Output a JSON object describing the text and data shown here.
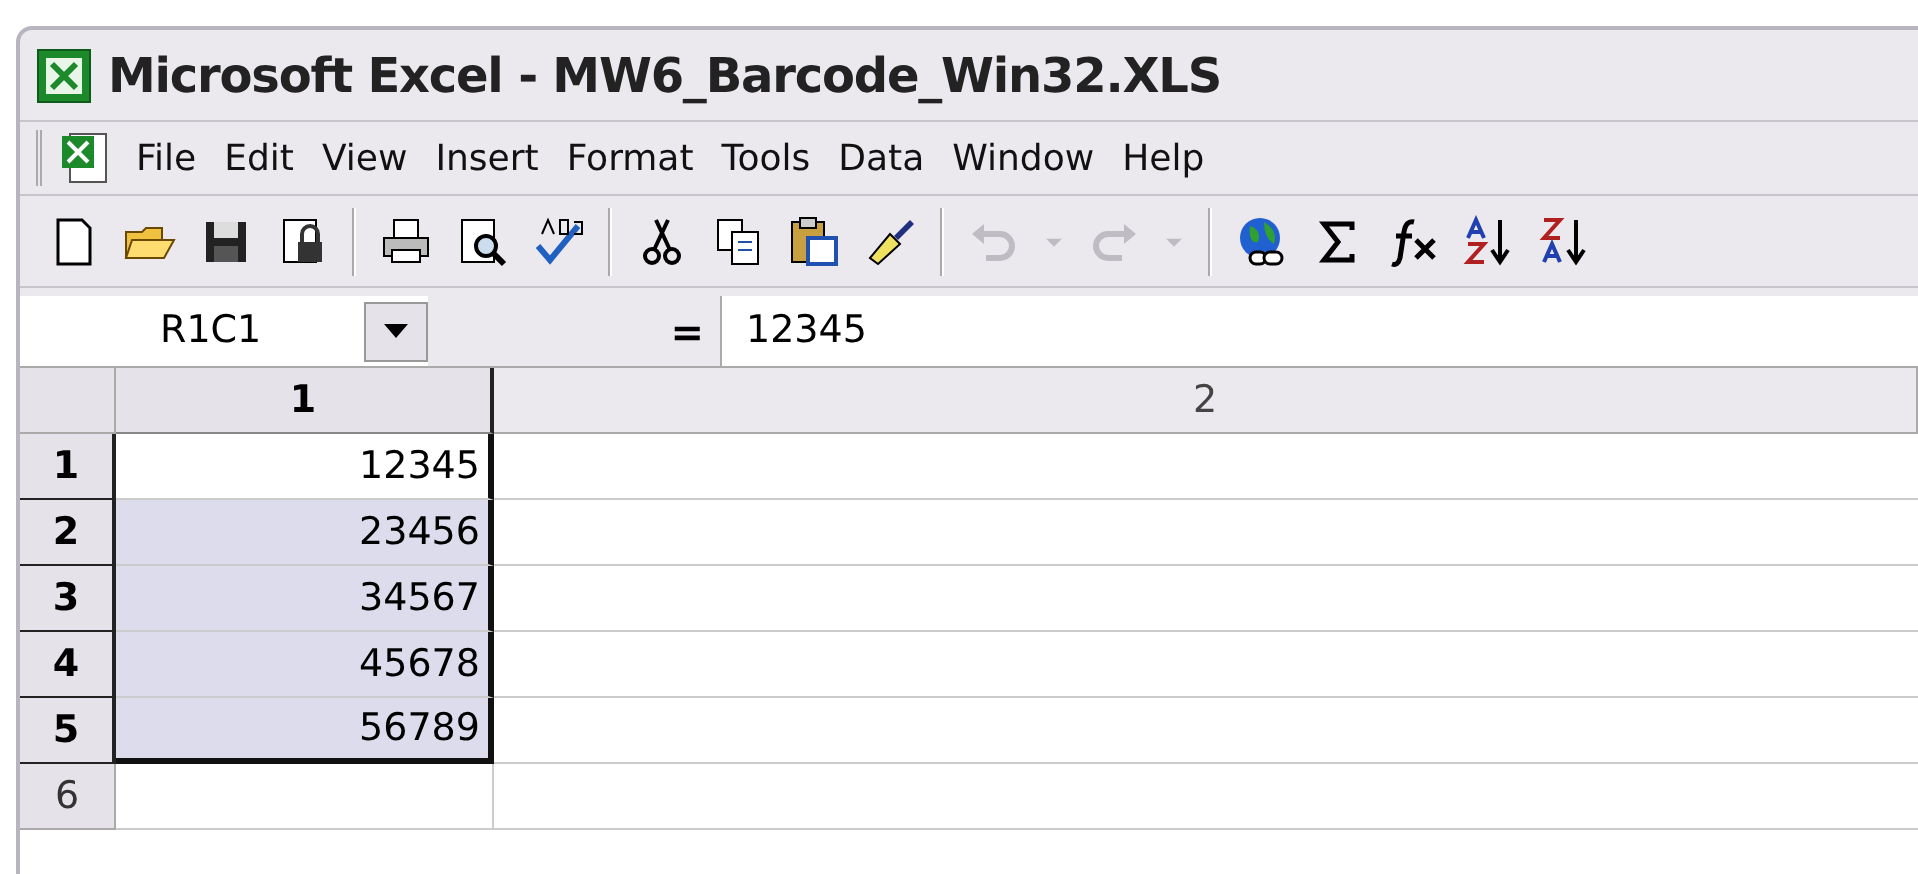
{
  "window": {
    "title": "Microsoft Excel - MW6_Barcode_Win32.XLS"
  },
  "menu": [
    {
      "label": "File"
    },
    {
      "label": "Edit"
    },
    {
      "label": "View"
    },
    {
      "label": "Insert"
    },
    {
      "label": "Format"
    },
    {
      "label": "Tools"
    },
    {
      "label": "Data"
    },
    {
      "label": "Window"
    },
    {
      "label": "Help"
    }
  ],
  "toolbar": [
    {
      "kind": "new",
      "disabled": false
    },
    {
      "kind": "open",
      "disabled": false
    },
    {
      "kind": "save",
      "disabled": false
    },
    {
      "kind": "permission",
      "disabled": false
    },
    {
      "kind": "sep"
    },
    {
      "kind": "print",
      "disabled": false
    },
    {
      "kind": "preview",
      "disabled": false
    },
    {
      "kind": "spelling",
      "disabled": false
    },
    {
      "kind": "sep"
    },
    {
      "kind": "cut",
      "disabled": false
    },
    {
      "kind": "copy",
      "disabled": false
    },
    {
      "kind": "paste",
      "disabled": false
    },
    {
      "kind": "painter",
      "disabled": false
    },
    {
      "kind": "sep"
    },
    {
      "kind": "undo",
      "disabled": true
    },
    {
      "kind": "drop",
      "disabled": true
    },
    {
      "kind": "redo",
      "disabled": true
    },
    {
      "kind": "drop",
      "disabled": true
    },
    {
      "kind": "sep"
    },
    {
      "kind": "hyperlink",
      "disabled": false
    },
    {
      "kind": "sigma",
      "disabled": false
    },
    {
      "kind": "fx",
      "disabled": false
    },
    {
      "kind": "sortasc",
      "disabled": false
    },
    {
      "kind": "sortdesc",
      "disabled": false
    }
  ],
  "formula_bar": {
    "name_box": "R1C1",
    "equals": "=",
    "value": "12345"
  },
  "sheet": {
    "columns": [
      {
        "label": "1",
        "selected": true
      },
      {
        "label": "2",
        "selected": false
      }
    ],
    "rows": [
      {
        "label": "1",
        "selected": true,
        "active": true,
        "cells": [
          "12345",
          ""
        ]
      },
      {
        "label": "2",
        "selected": true,
        "active": false,
        "cells": [
          "23456",
          ""
        ]
      },
      {
        "label": "3",
        "selected": true,
        "active": false,
        "cells": [
          "34567",
          ""
        ]
      },
      {
        "label": "4",
        "selected": true,
        "active": false,
        "cells": [
          "45678",
          ""
        ]
      },
      {
        "label": "5",
        "selected": true,
        "active": false,
        "cells": [
          "56789",
          ""
        ]
      },
      {
        "label": "6",
        "selected": false,
        "active": false,
        "cells": [
          "",
          ""
        ]
      }
    ]
  }
}
